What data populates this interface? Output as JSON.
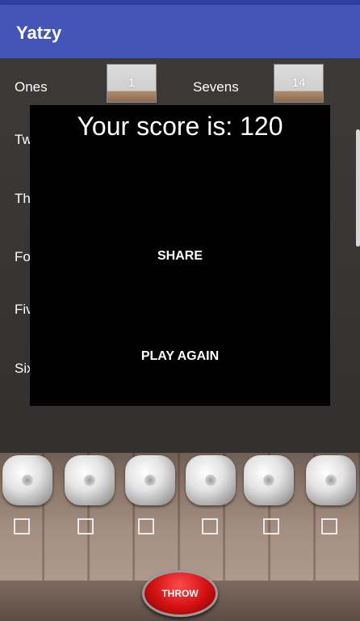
{
  "app": {
    "title": "Yatzy"
  },
  "scoreboard": {
    "left": [
      {
        "label": "Ones",
        "value": "1"
      },
      {
        "label": "Tw"
      },
      {
        "label": "Th"
      },
      {
        "label": "Fo"
      },
      {
        "label": "Fiv"
      },
      {
        "label": "Six"
      }
    ],
    "right": [
      {
        "label": "Sevens",
        "value": "14"
      }
    ]
  },
  "dialog": {
    "message": "Your score is: 120",
    "share_label": "SHARE",
    "play_again_label": "PLAY AGAIN"
  },
  "dice": {
    "count": 6
  },
  "controls": {
    "throw_label": "THROW"
  }
}
